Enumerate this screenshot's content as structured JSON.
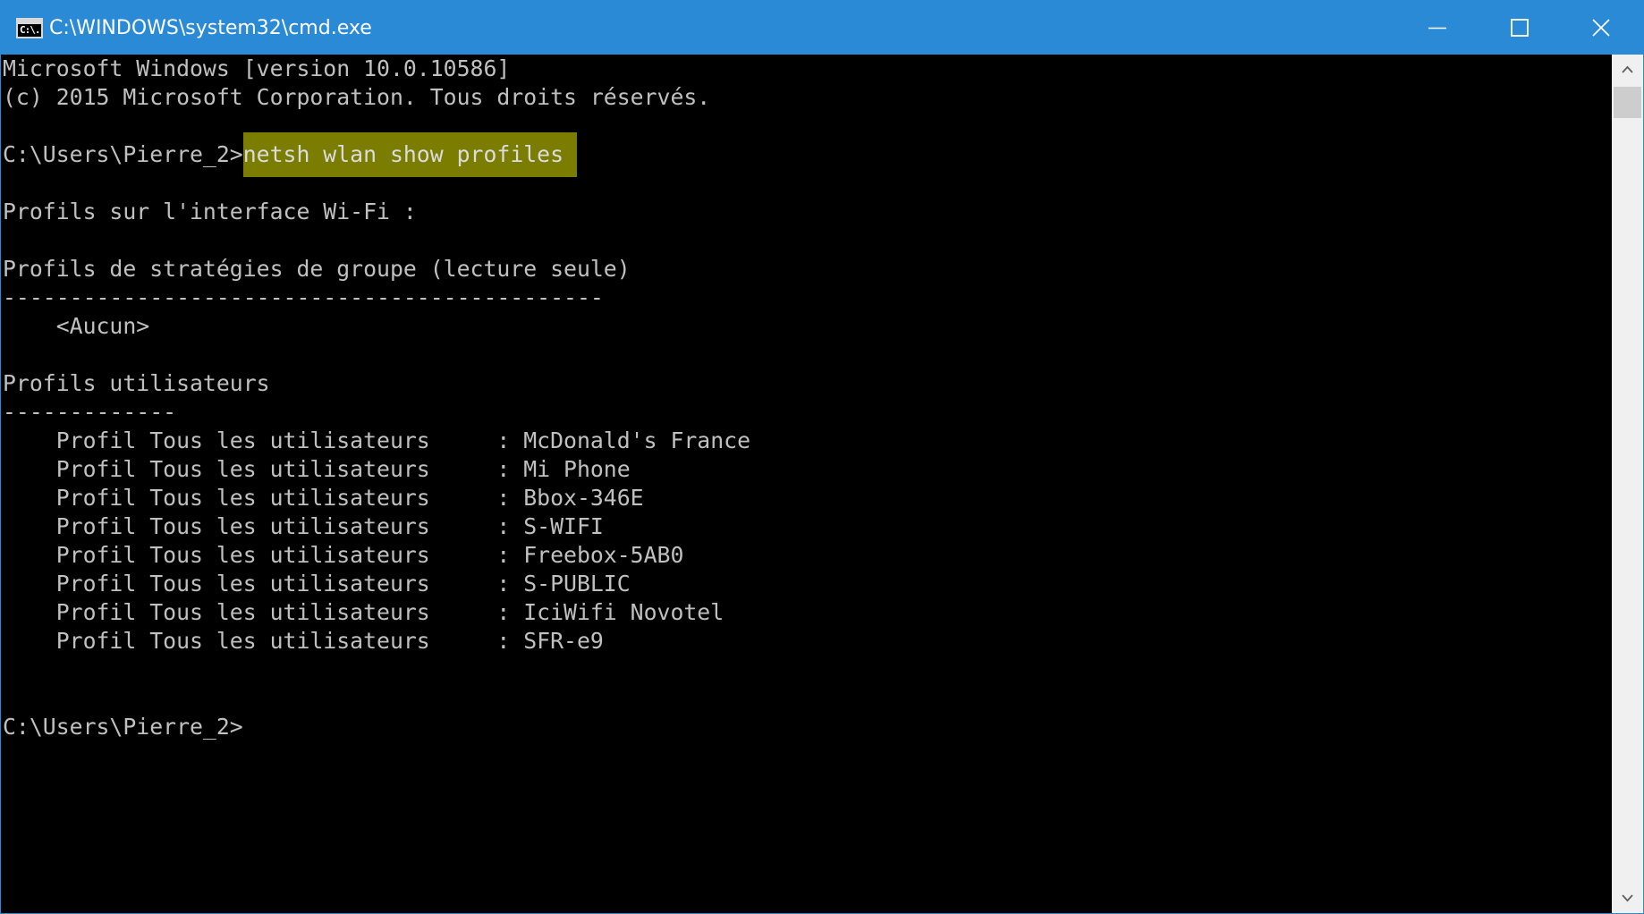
{
  "window": {
    "title": "C:\\WINDOWS\\system32\\cmd.exe",
    "icon_text": "C:\\.",
    "controls": [
      "minimize-icon",
      "maximize-icon",
      "close-icon"
    ],
    "accent_color": "#2b8ad6"
  },
  "console": {
    "lines": [
      {
        "prompt": "Microsoft Windows [version 10.0.10586]"
      },
      {
        "prompt": "(c) 2015 Microsoft Corporation. Tous droits réservés."
      },
      {
        "prompt": "C:\\Users\\Pierre_2>",
        "command": "netsh wlan show profiles"
      },
      {
        "prompt": "Profils sur l'interface Wi-Fi :"
      },
      {
        "prompt": "Profils de stratégies de groupe (lecture seule)"
      },
      {
        "prompt": "---------------------------------------------"
      },
      {
        "prompt": "    <Aucun>"
      },
      {
        "prompt": "Profils utilisateurs"
      },
      {
        "prompt": "-------------"
      },
      {
        "prompt": "    Profil Tous les utilisateurs     : McDonald's France"
      },
      {
        "prompt": "    Profil Tous les utilisateurs     : Mi Phone"
      },
      {
        "prompt": "    Profil Tous les utilisateurs     : Bbox-346E"
      },
      {
        "prompt": "    Profil Tous les utilisateurs     : S-WIFI"
      },
      {
        "prompt": "    Profil Tous les utilisateurs     : Freebox-5AB0"
      },
      {
        "prompt": "    Profil Tous les utilisateurs     : S-PUBLIC"
      },
      {
        "prompt": "    Profil Tous les utilisateurs     : IciWifi Novotel"
      },
      {
        "prompt": "    Profil Tous les utilisateurs     : SFR-e9"
      },
      {
        "prompt": "C:\\Users\\Pierre_2>"
      }
    ],
    "highlight_color": "#7a7d00"
  }
}
